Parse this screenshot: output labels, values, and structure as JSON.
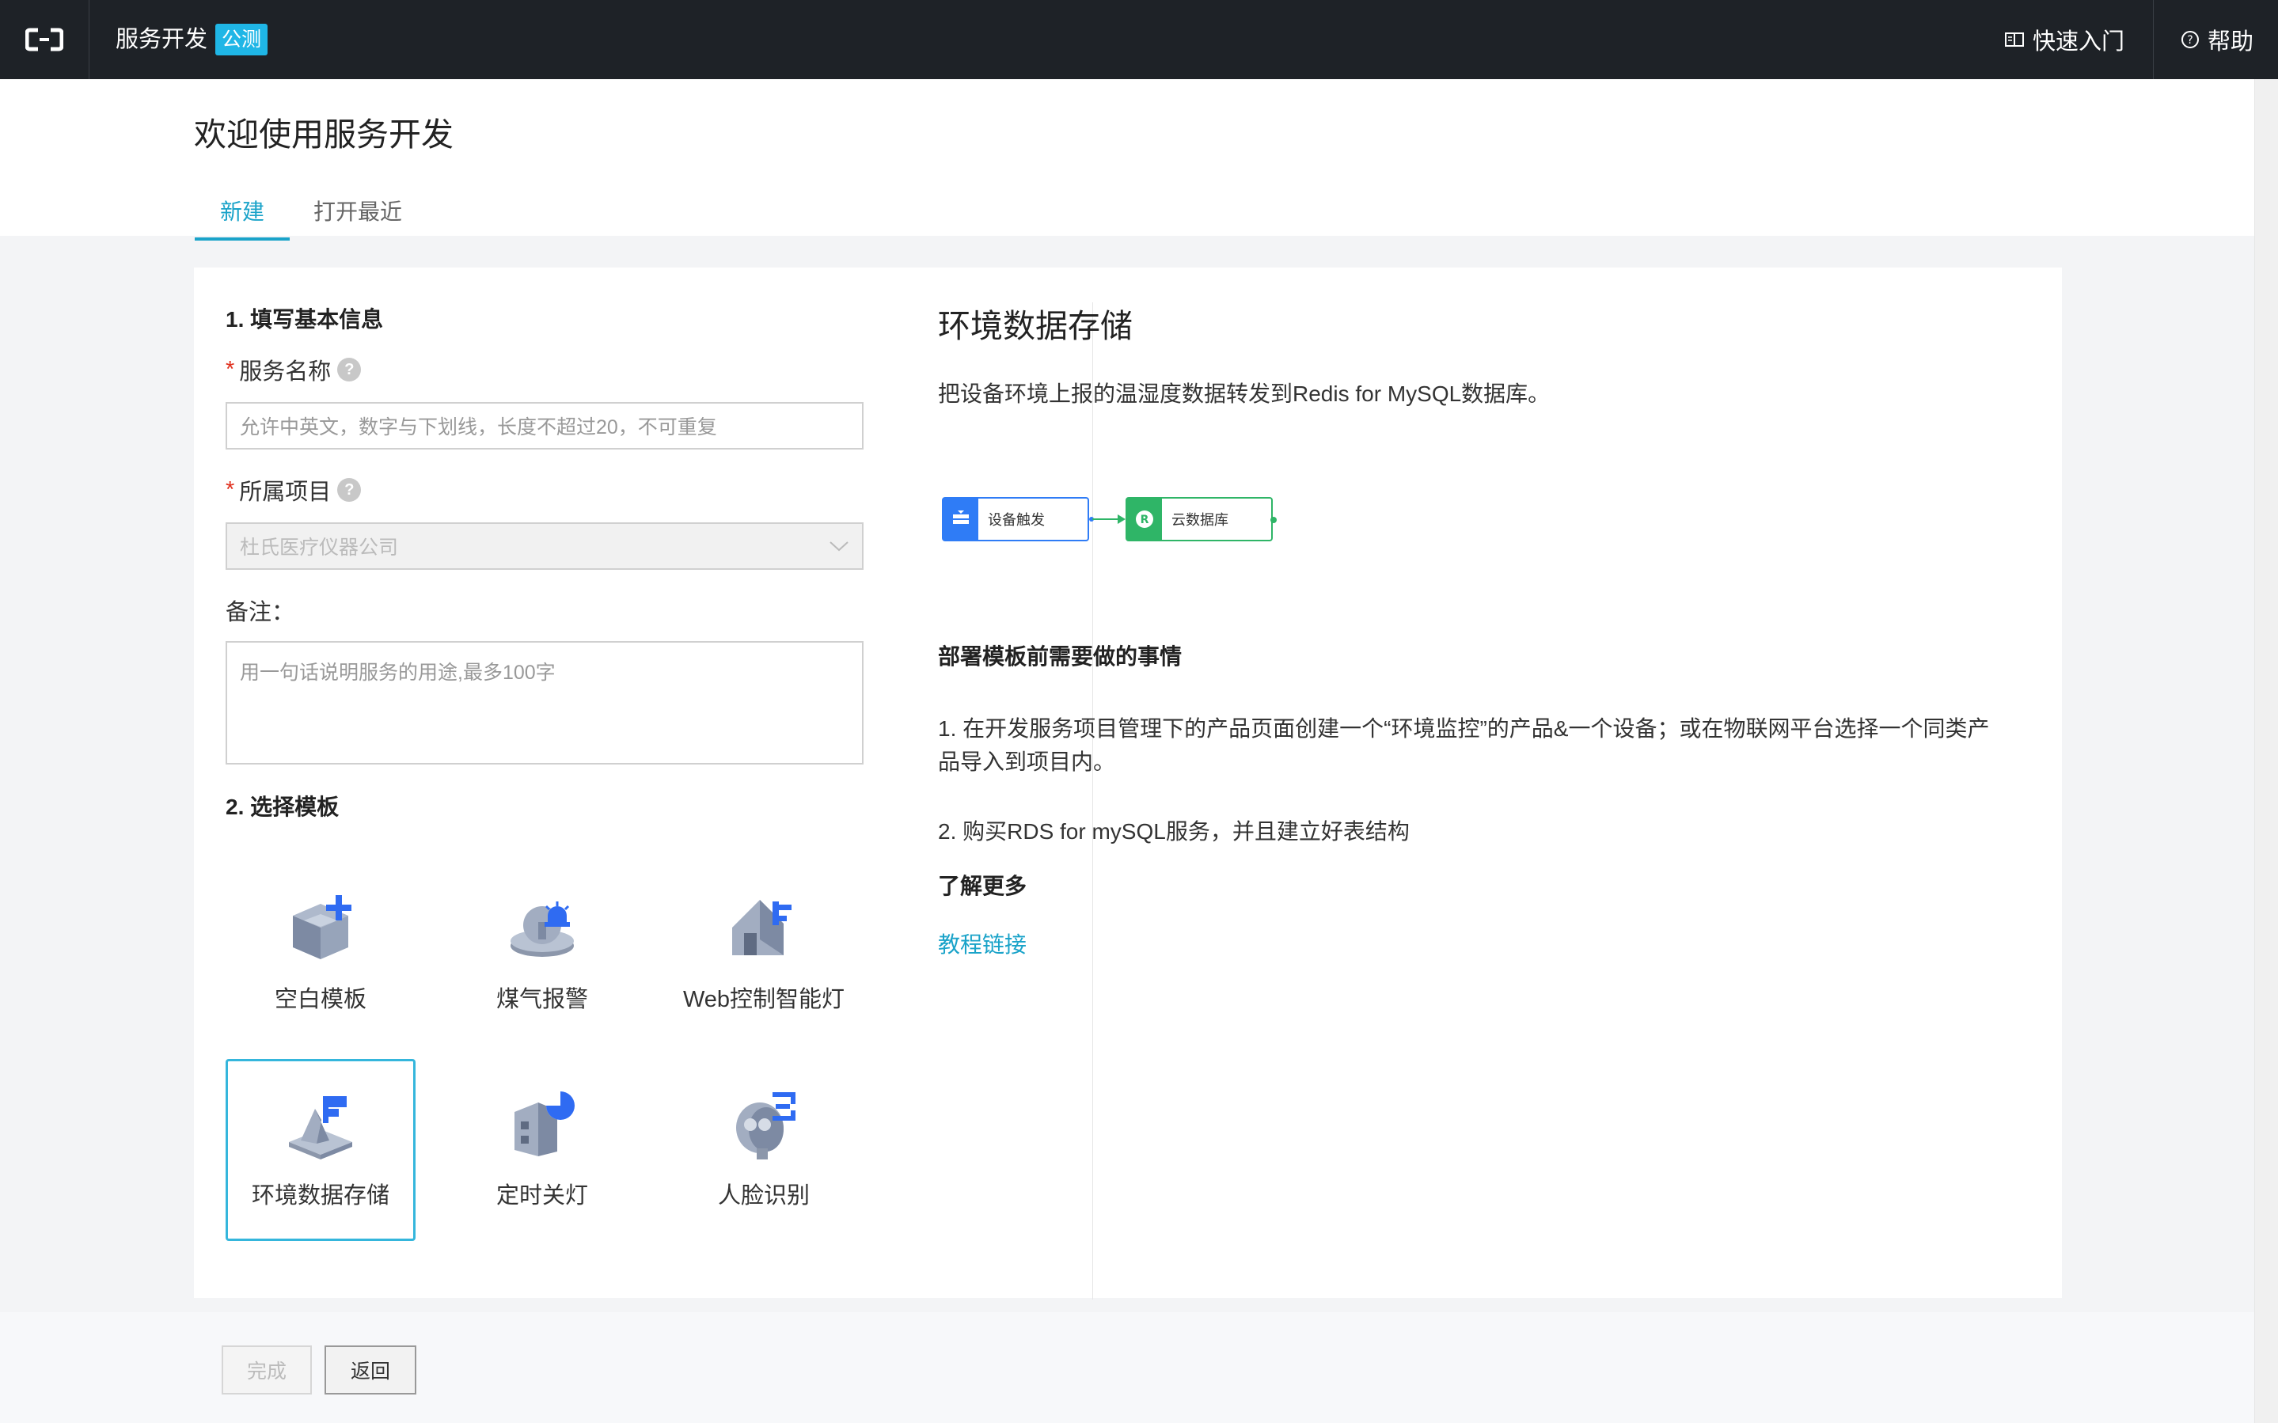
{
  "topbar": {
    "app_title": "服务开发",
    "beta_badge": "公测",
    "quickstart_label": "快速入门",
    "help_label": "帮助"
  },
  "header": {
    "page_title": "欢迎使用服务开发",
    "tabs": [
      {
        "label": "新建",
        "active": true
      },
      {
        "label": "打开最近",
        "active": false
      }
    ]
  },
  "form": {
    "section1_title": "1. 填写基本信息",
    "service_name": {
      "label": "服务名称",
      "placeholder": "允许中英文，数字与下划线，长度不超过20，不可重复",
      "value": ""
    },
    "project": {
      "label": "所属项目",
      "value": "杜氏医疗仪器公司"
    },
    "note": {
      "label": "备注：",
      "placeholder": "用一句话说明服务的用途,最多100字"
    },
    "section2_title": "2. 选择模板",
    "templates": [
      {
        "label": "空白模板",
        "icon": "blank-template-icon",
        "selected": false
      },
      {
        "label": "煤气报警",
        "icon": "gas-alarm-icon",
        "selected": false
      },
      {
        "label": "Web控制智能灯",
        "icon": "smart-light-icon",
        "selected": false
      },
      {
        "label": "环境数据存储",
        "icon": "env-storage-icon",
        "selected": true
      },
      {
        "label": "定时关灯",
        "icon": "timer-light-icon",
        "selected": false
      },
      {
        "label": "人脸识别",
        "icon": "face-recognition-icon",
        "selected": false
      }
    ]
  },
  "detail": {
    "title": "环境数据存储",
    "description": "把设备环境上报的温湿度数据转发到Redis for MySQL数据库。",
    "flow": [
      {
        "label": "设备触发",
        "color": "#2f7cf6"
      },
      {
        "label": "云数据库",
        "color": "#2fb567"
      }
    ],
    "steps_title": "部署模板前需要做的事情",
    "steps": [
      "1. 在开发服务项目管理下的产品页面创建一个“环境监控”的产品&一个设备；或在物联网平台选择一个同类产品导入到项目内。",
      "2. 购买RDS for mySQL服务，并且建立好表结构"
    ],
    "learn_more_title": "了解更多",
    "tutorial_link": "教程链接"
  },
  "footer": {
    "done_label": "完成",
    "back_label": "返回"
  },
  "colors": {
    "accent": "#1aa3c9",
    "topbar": "#1e2227",
    "badge": "#1fb6e6"
  }
}
